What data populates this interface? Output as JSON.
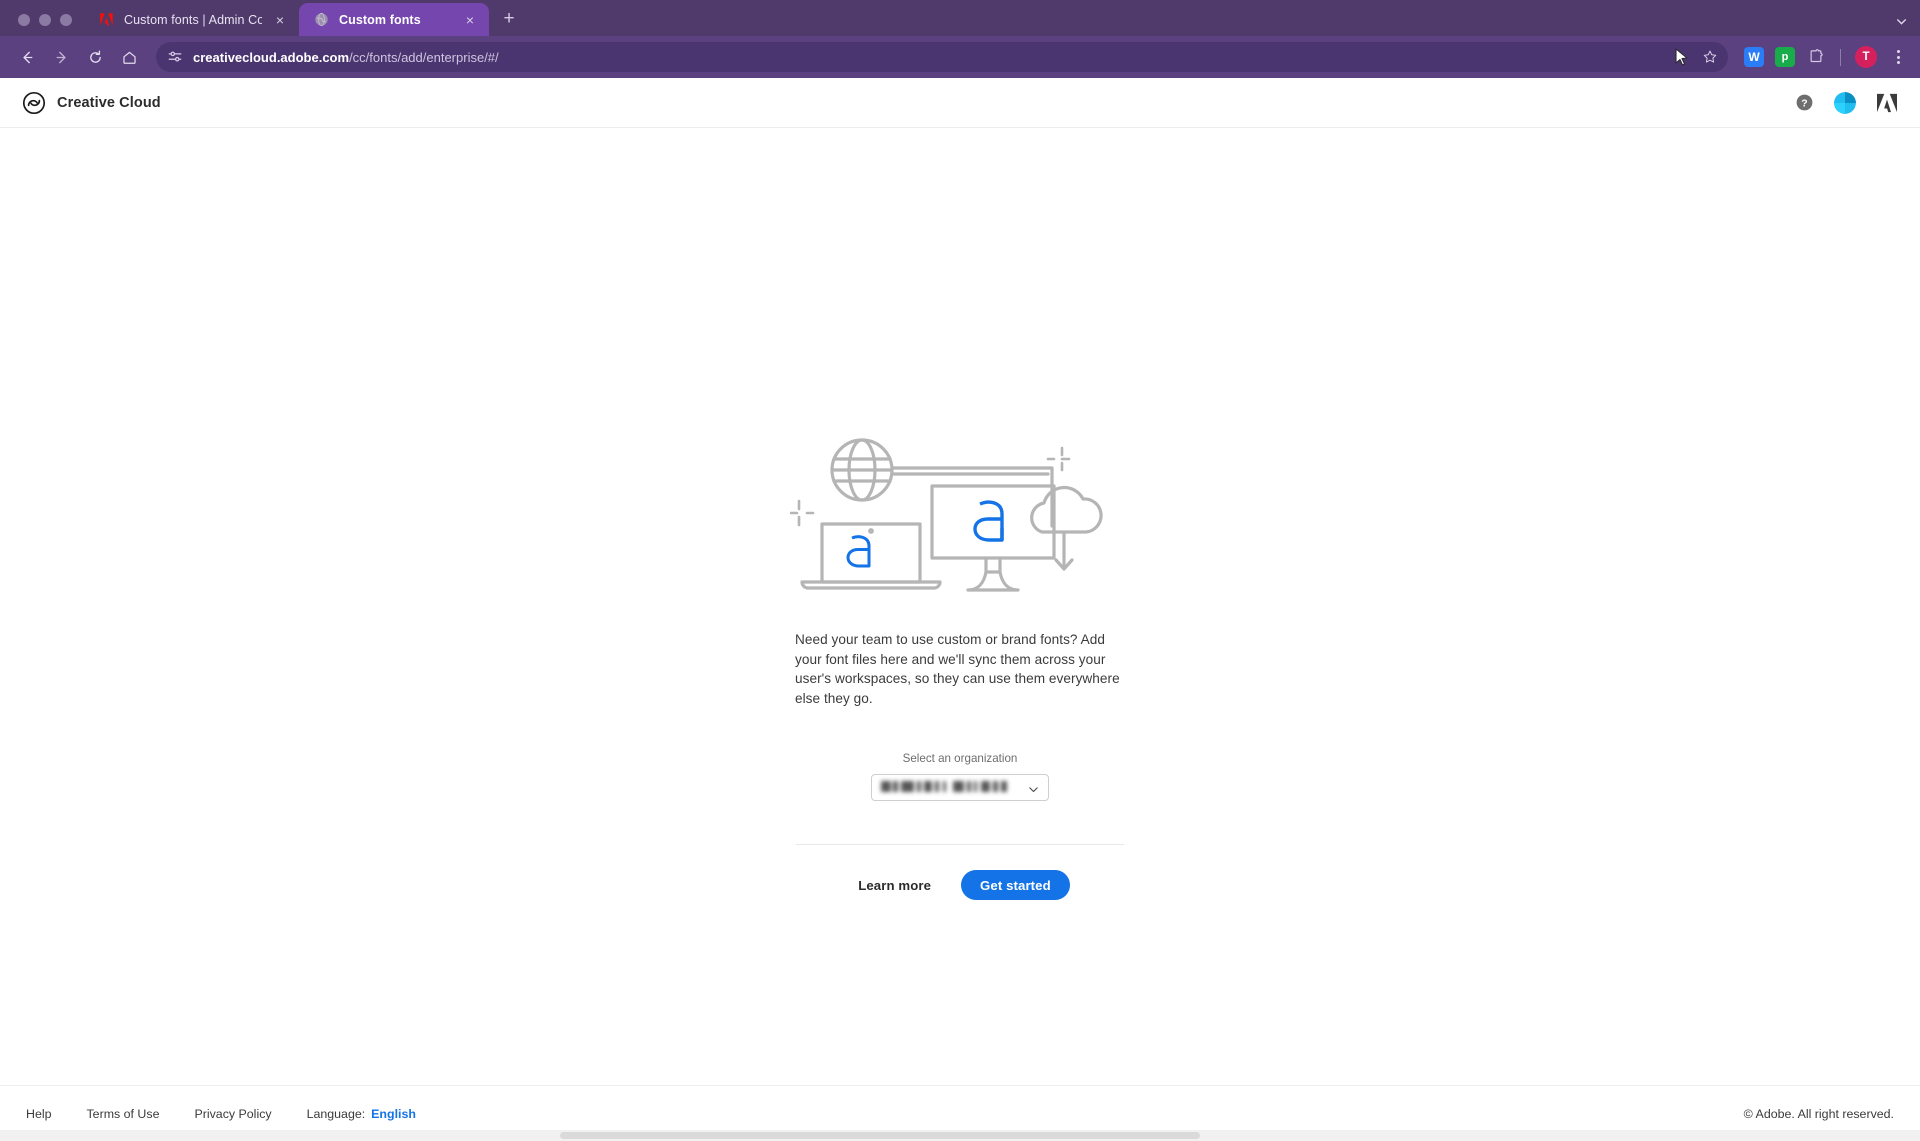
{
  "browser": {
    "tabs": [
      {
        "title": "Custom fonts | Admin Console",
        "favicon": "adobe-red-logo",
        "active": false
      },
      {
        "title": "Custom fonts",
        "favicon": "generic-globe",
        "active": true
      }
    ],
    "new_tab_label": "+",
    "tab_close_label": "×",
    "tablist_chevron": "⌄",
    "nav": {
      "back_label": "←",
      "forward_label": "→",
      "reload_label": "↻",
      "home_label": "home-icon"
    },
    "omnibox": {
      "site_settings_icon": "tune-icon",
      "url_domain": "creativecloud.adobe.com",
      "url_path": "/cc/fonts/add/enterprise/#/",
      "bookmark_icon": "star-outline-icon"
    },
    "extensions": [
      {
        "name": "workona-extension",
        "glyph": "W",
        "color": "#2a7cf7"
      },
      {
        "name": "pinterest-extension",
        "glyph": "p",
        "color": "#18ad4a"
      },
      {
        "name": "extensions-puzzle",
        "glyph": "puzzle-icon",
        "color": "#5b4180"
      }
    ],
    "profile_initial": "T",
    "menu_icon": "kebab-menu-icon"
  },
  "app_header": {
    "logo_name": "creative-cloud-logo",
    "brand": "Creative Cloud",
    "help_icon": "help-circle-icon",
    "avatar_name": "user-avatar",
    "adobe_logo": "adobe-a-logo"
  },
  "main": {
    "illustration_name": "fonts-sync-illustration",
    "blurb": "Need your team to use custom or brand fonts? Add your font files here and we'll sync them across your user's workspaces, so they can use them everywhere else they go.",
    "org_label": "Select an organization",
    "org_value": "",
    "org_value_redacted": true,
    "caret_icon": "chevron-down-icon",
    "learn_more": "Learn more",
    "get_started": "Get started",
    "accent_color": "#1473e6"
  },
  "footer": {
    "links": [
      "Help",
      "Terms of Use",
      "Privacy Policy"
    ],
    "language_label": "Language:",
    "language_value": "English",
    "copyright": "© Adobe. All right reserved."
  }
}
